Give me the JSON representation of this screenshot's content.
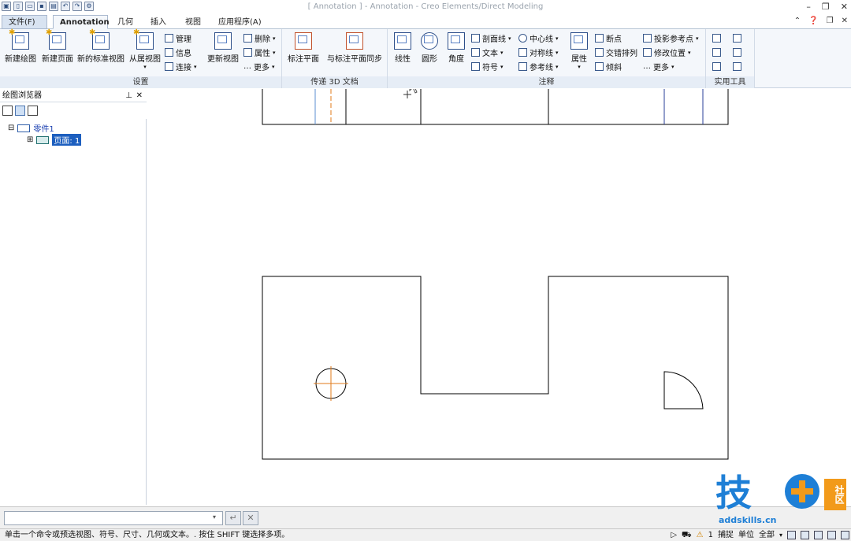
{
  "window": {
    "title": "[ Annotation ] - Annotation - Creo Elements/Direct Modeling"
  },
  "tabs": {
    "file": "文件(F)",
    "annotation": "Annotation",
    "geometry": "几何",
    "insert": "插入",
    "view": "视图",
    "apps": "应用程序(A)"
  },
  "ribbon": {
    "setup": {
      "label": "设置",
      "new_drawing": "新建绘图",
      "new_page": "新建页面",
      "new_std_views": "新的标准视图",
      "from_views": "从属视图",
      "manage": "管理",
      "info": "信息",
      "connect": "连接",
      "update_view": "更新视图",
      "delete": "删除",
      "props": "属性",
      "more": "更多"
    },
    "transfer3d": {
      "label": "传递 3D 文档",
      "annot_plane": "标注平面",
      "sync_plane": "与标注平面同步"
    },
    "annotation": {
      "label": "注释",
      "linear": "线性",
      "radial": "圆形",
      "angle": "角度",
      "section_line": "剖面线",
      "text": "文本",
      "symbol": "符号",
      "centerline": "中心线",
      "symmetric": "对称线",
      "ref_line": "参考线",
      "props": "属性",
      "break": "断点",
      "stagger": "交错排列",
      "tilt": "倾斜",
      "proj_ref": "投影参考点",
      "modify_pos": "修改位置",
      "more": "更多"
    },
    "tools": {
      "label": "实用工具"
    }
  },
  "browser": {
    "title": "绘图浏览器",
    "part": "零件1",
    "page": "页面: 1"
  },
  "command": {
    "value": ""
  },
  "status": {
    "hint": "单击一个命令或预选视图、符号、尺寸、几何或文本。. 按住 SHIFT 键选择多项。",
    "count": "1",
    "snap": "捕捉",
    "unit": "单位",
    "filter": "全部"
  },
  "watermark": {
    "text": "addskills.cn",
    "brand": "技",
    "badge": "社区"
  }
}
